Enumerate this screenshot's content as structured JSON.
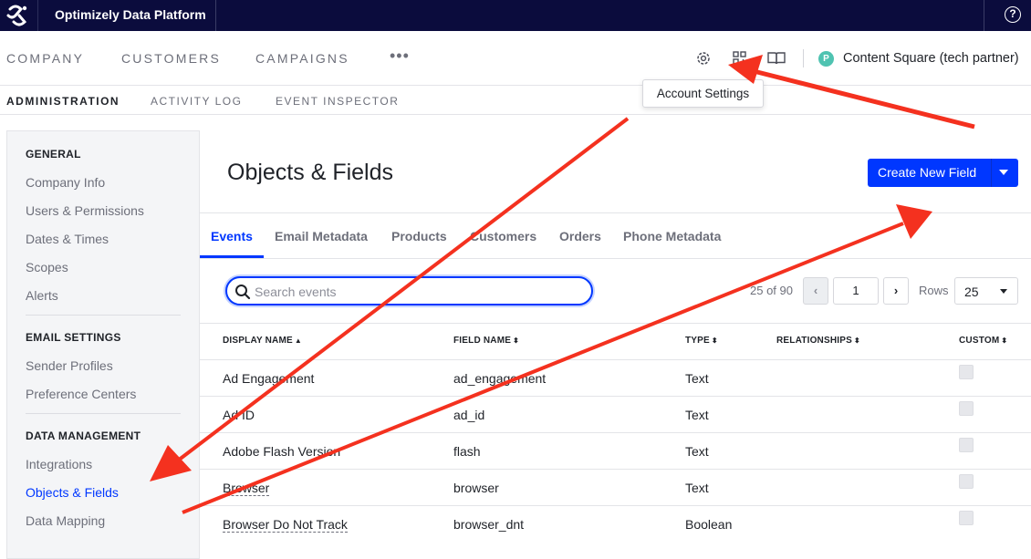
{
  "topbar": {
    "app_title": "Optimizely Data Platform",
    "help_glyph": "?"
  },
  "primary_nav": {
    "items": [
      "COMPANY",
      "CUSTOMERS",
      "CAMPAIGNS"
    ],
    "more": "•••",
    "icons": [
      "gear-icon",
      "apps-icon",
      "book-icon"
    ],
    "account": {
      "avatar_letter": "P",
      "name": "Content Square (tech partner)"
    }
  },
  "secondary_nav": {
    "items": [
      "ADMINISTRATION",
      "ACTIVITY LOG",
      "EVENT INSPECTOR"
    ],
    "active": "ADMINISTRATION"
  },
  "tooltip": {
    "text": "Account Settings"
  },
  "sidebar": {
    "sections": [
      {
        "heading": "GENERAL",
        "items": [
          "Company Info",
          "Users & Permissions",
          "Dates & Times",
          "Scopes",
          "Alerts"
        ]
      },
      {
        "heading": "EMAIL SETTINGS",
        "items": [
          "Sender Profiles",
          "Preference Centers"
        ]
      },
      {
        "heading": "DATA MANAGEMENT",
        "items": [
          "Integrations",
          "Objects & Fields",
          "Data Mapping"
        ]
      }
    ],
    "active_item": "Objects & Fields"
  },
  "main": {
    "title": "Objects & Fields",
    "create_button": "Create New Field",
    "tabs": [
      "Events",
      "Email Metadata",
      "Products",
      "Customers",
      "Orders",
      "Phone Metadata"
    ],
    "active_tab": "Events",
    "search_placeholder": "Search events",
    "pagination": {
      "range": "25 of 90",
      "prev": "‹",
      "page": "1",
      "next": "›",
      "rows_label": "Rows",
      "rows_value": "25"
    }
  },
  "table": {
    "columns": [
      "DISPLAY NAME",
      "FIELD NAME",
      "TYPE",
      "RELATIONSHIPS",
      "CUSTOM"
    ],
    "sort_glyphs": [
      "▲",
      "⬍",
      "⬍",
      "⬍",
      "⬍"
    ],
    "rows": [
      {
        "display": "Ad Engagement",
        "field": "ad_engagement",
        "type": "Text"
      },
      {
        "display": "Ad ID",
        "field": "ad_id",
        "type": "Text"
      },
      {
        "display": "Adobe Flash Version",
        "field": "flash",
        "type": "Text"
      },
      {
        "display": "Browser",
        "field": "browser",
        "type": "Text"
      },
      {
        "display": "Browser Do Not Track",
        "field": "browser_dnt",
        "type": "Boolean"
      }
    ]
  },
  "colors": {
    "accent": "#0037ff",
    "annotation_arrow": "#f4311f",
    "topbar": "#0b0c3d"
  }
}
